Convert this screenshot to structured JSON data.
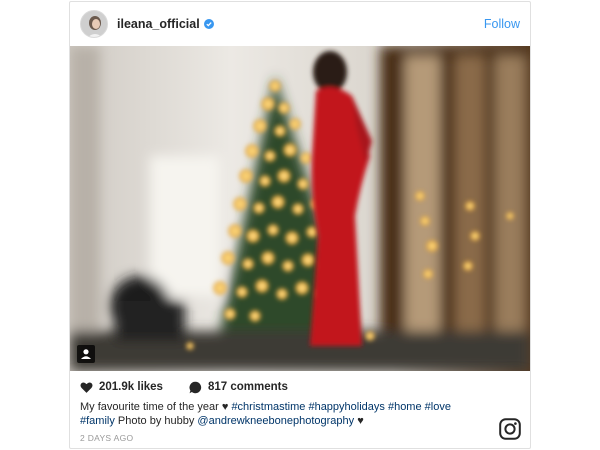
{
  "header": {
    "username": "ileana_official",
    "follow_label": "Follow",
    "verified_icon": "verified-badge-icon",
    "accent_color": "#3897f0"
  },
  "post": {
    "likes": "201.9k likes",
    "comments": "817 comments",
    "caption_text": "My favourite time of the year",
    "caption_heart": "♥",
    "hashtags_line1": "#christmastime #happyholidays #home #love",
    "caption_line2_tag": "#family",
    "caption_line2_text": "Photo by hubby",
    "mention": "@andrewkneebonephotography",
    "caption_end_heart": "♥",
    "timestamp": "2 DAYS AGO"
  },
  "icons": {
    "like": "heart-icon",
    "comment": "comment-bubble-icon",
    "tagged": "person-tag-icon",
    "brand": "instagram-logo-icon"
  }
}
